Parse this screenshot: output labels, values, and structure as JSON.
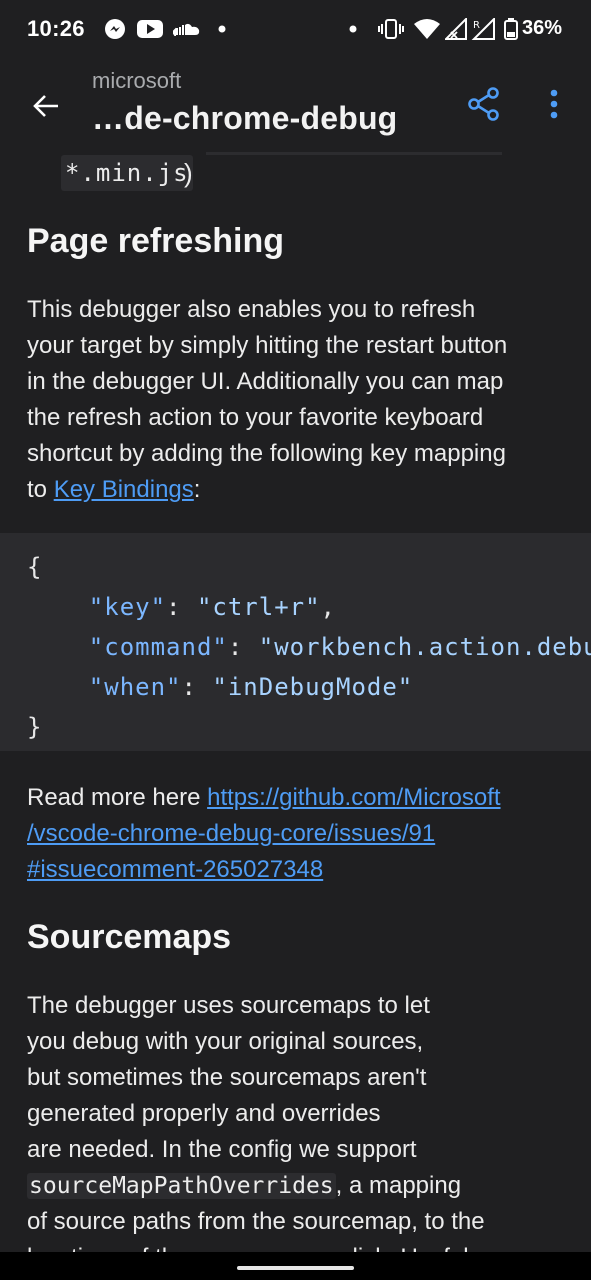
{
  "status_bar": {
    "time": "10:26",
    "battery": "36%",
    "icons": [
      "messenger-icon",
      "youtube-icon",
      "soundcloud-icon",
      "dot-icon",
      "dot-icon",
      "vibrate-icon",
      "wifi-icon",
      "signal-icon",
      "signal-roaming-icon",
      "battery-icon"
    ]
  },
  "app_bar": {
    "owner": "microsoft",
    "repo": "…de-chrome-debug",
    "accent": "#4e9cf5"
  },
  "content": {
    "inline_code_top": "*.min.js",
    "paren": ")",
    "section1_title": "Page refreshing",
    "section1_lines": [
      "This debugger also enables you to refresh",
      "your target by simply hitting the restart button",
      "in the debugger UI. Additionally you can map",
      "the refresh action to your favorite keyboard",
      "shortcut by adding the following key mapping"
    ],
    "section1_last_prefix": "to ",
    "key_bindings_link": "Key Bindings",
    "section1_last_suffix": ":",
    "code": {
      "open": "{",
      "key_k": "\"key\"",
      "key_v": "\"ctrl+r\"",
      "command_k": "\"command\"",
      "command_v": "\"workbench.action.debug.restart\"",
      "when_k": "\"when\"",
      "when_v": "\"inDebugMode\"",
      "close": "}"
    },
    "read_more_prefix": "Read more here ",
    "read_more_link_lines": [
      "https://github.com/Microsoft",
      "/vscode-chrome-debug-core/issues/91",
      "#issuecomment-265027348"
    ],
    "section2_title": "Sourcemaps",
    "section2_lines": [
      "The debugger uses sourcemaps to let",
      "you debug with your original sources,",
      "but sometimes the sourcemaps aren't",
      "generated properly and overrides",
      "are needed. In the config we support"
    ],
    "section2_code": "sourceMapPathOverrides",
    "section2_after_code": ", a mapping",
    "section2_line7": "of source paths from the sourcemap, to the",
    "section2_line8": "locations of these sources on disk. Useful"
  }
}
